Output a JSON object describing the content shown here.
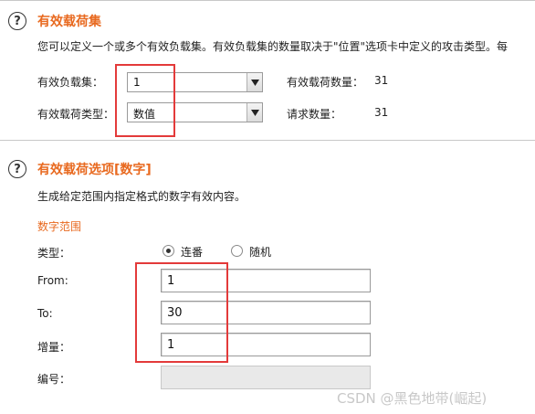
{
  "payload_sets": {
    "title": "有效载荷集",
    "description": "您可以定义一个或多个有效负载集。有效负载集的数量取决于\"位置\"选项卡中定义的攻击类型。每",
    "payload_set_label": "有效负载集：",
    "payload_set_value": "1",
    "payload_type_label": "有效载荷类型：",
    "payload_type_value": "数值",
    "payload_count_label": "有效载荷数量：",
    "payload_count_value": "31",
    "request_count_label": "请求数量：",
    "request_count_value": "31"
  },
  "payload_options": {
    "title": "有效载荷选项[数字]",
    "description": "生成给定范围内指定格式的数字有效内容。",
    "range_title": "数字范围",
    "type_label": "类型：",
    "sequential_label": "连番",
    "random_label": "随机",
    "sequential_selected": true,
    "from_label": "From:",
    "from_value": "1",
    "to_label": "To:",
    "to_value": "30",
    "step_label": "增量：",
    "step_value": "1",
    "number_label": "编号：",
    "number_value": ""
  },
  "watermark": "CSDN @黑色地带(崛起)",
  "colors": {
    "accent": "#e8691f",
    "highlight": "#e33a3a"
  },
  "icons": {
    "help": "help-icon",
    "dropdown": "chevron-down-icon"
  }
}
